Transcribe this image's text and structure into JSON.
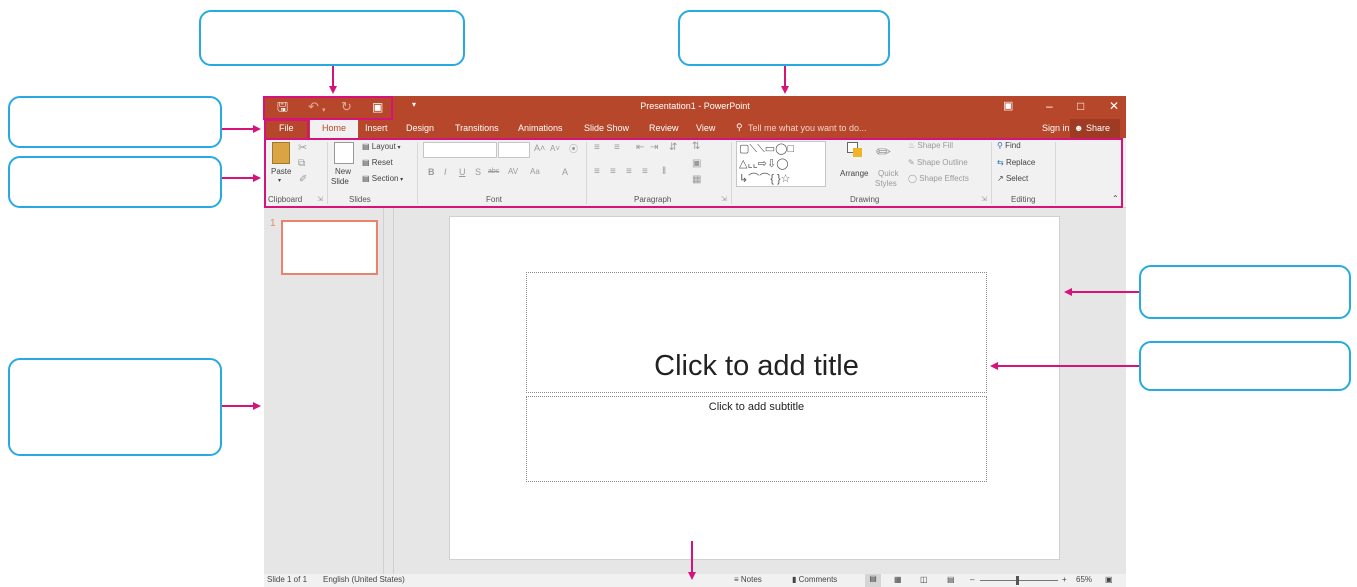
{
  "window": {
    "title": "Presentation1 - PowerPoint",
    "sign_in": "Sign in",
    "share": "Share",
    "qat_icons": [
      "save-icon",
      "undo-icon",
      "redo-icon",
      "start-from-beginning-icon",
      "customize-qat-icon"
    ]
  },
  "tabs": {
    "file": "File",
    "home": "Home",
    "insert": "Insert",
    "design": "Design",
    "transitions": "Transitions",
    "animations": "Animations",
    "slideshow": "Slide Show",
    "review": "Review",
    "view": "View",
    "tell_me": "Tell me what you want to do..."
  },
  "ribbon": {
    "clipboard": {
      "label": "Clipboard",
      "paste": "Paste"
    },
    "slides": {
      "label": "Slides",
      "new_slide": "New",
      "new_slide2": "Slide",
      "layout": "Layout",
      "reset": "Reset",
      "section": "Section"
    },
    "font": {
      "label": "Font"
    },
    "paragraph": {
      "label": "Paragraph"
    },
    "drawing": {
      "label": "Drawing",
      "arrange": "Arrange",
      "quick": "Quick",
      "styles": "Styles",
      "shape_fill": "Shape Fill",
      "shape_outline": "Shape Outline",
      "shape_effects": "Shape Effects"
    },
    "editing": {
      "label": "Editing",
      "find": "Find",
      "replace": "Replace",
      "select": "Select"
    }
  },
  "thumbnails": {
    "slide_number": "1"
  },
  "slide": {
    "title_placeholder": "Click to add title",
    "subtitle_placeholder": "Click to add subtitle"
  },
  "status": {
    "slide_info": "Slide 1 of 1",
    "language": "English (United States)",
    "notes": "Notes",
    "comments": "Comments",
    "zoom": "65%"
  },
  "colors": {
    "accent": "#b7472a",
    "callout_border": "#27a9e1",
    "annotation_arrow": "#d6137b"
  }
}
